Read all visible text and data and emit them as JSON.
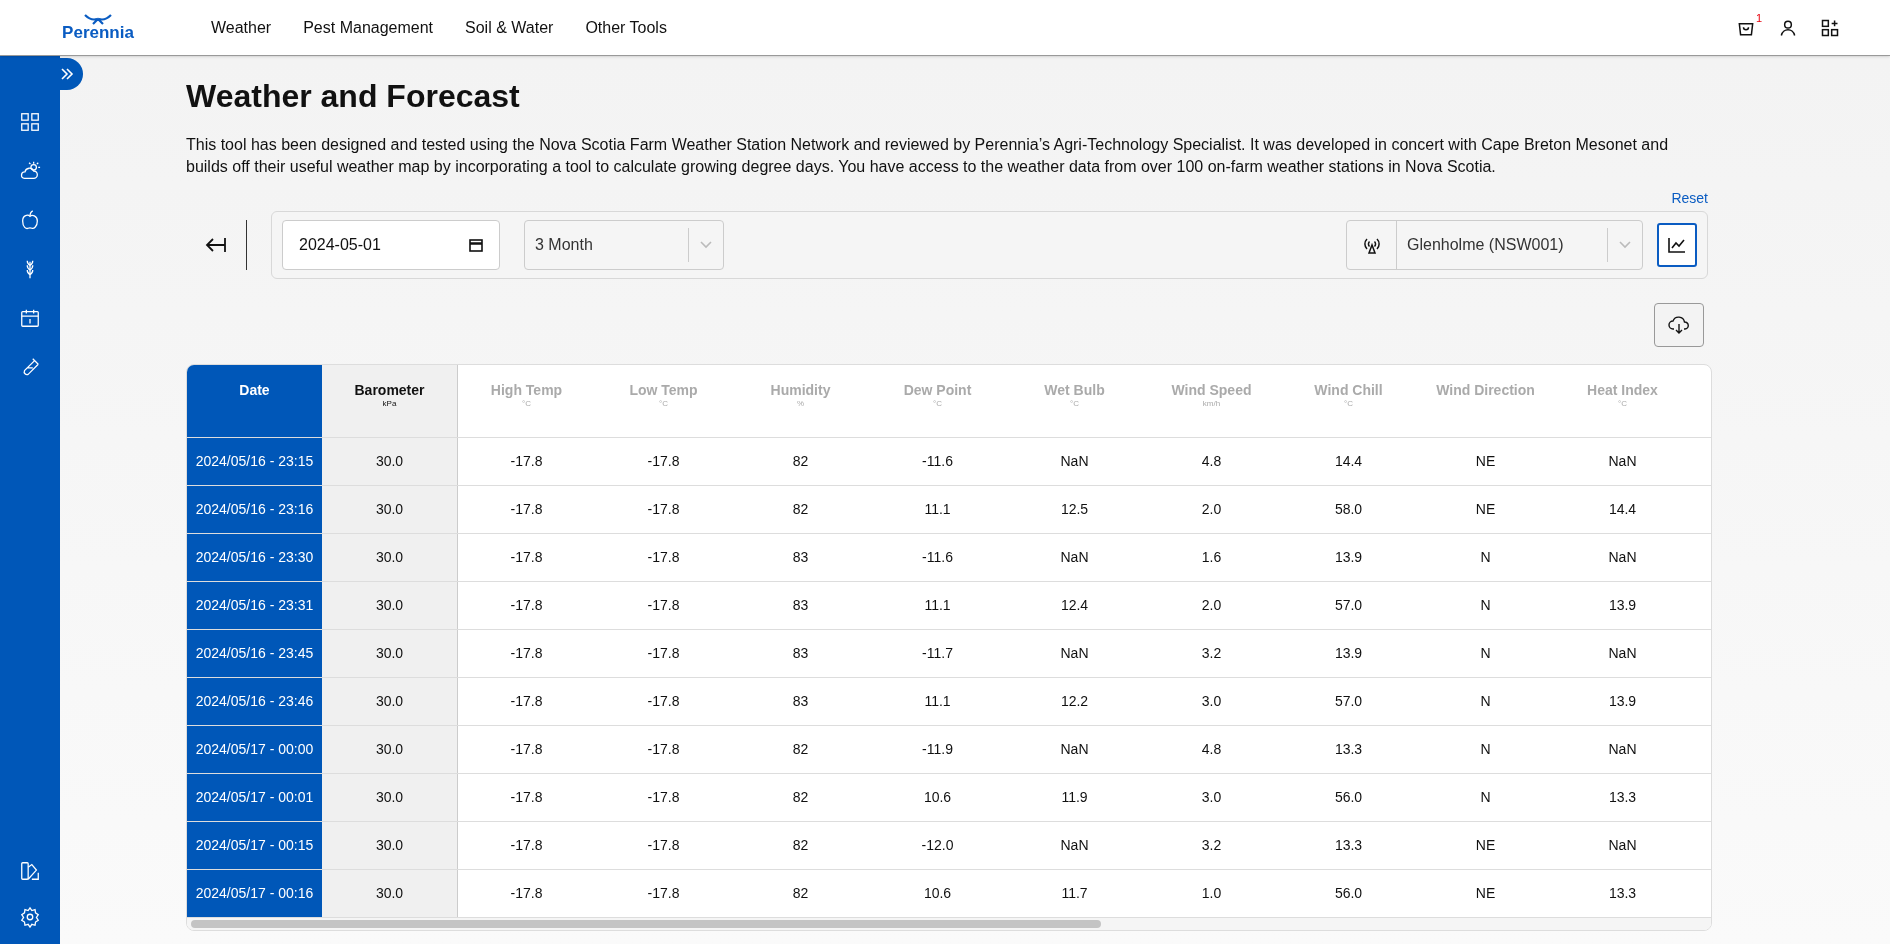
{
  "header": {
    "logo": "Perennia",
    "nav": [
      {
        "label": "Weather"
      },
      {
        "label": "Pest Management"
      },
      {
        "label": "Soil & Water"
      },
      {
        "label": "Other Tools"
      }
    ],
    "cart_badge": "1"
  },
  "sidebar": {
    "items": [
      {
        "kind": "grid"
      },
      {
        "kind": "weather"
      },
      {
        "kind": "apple"
      },
      {
        "kind": "wheat"
      },
      {
        "kind": "calendar"
      },
      {
        "kind": "tube"
      }
    ],
    "bottom_items": [
      {
        "kind": "palette"
      },
      {
        "kind": "settings"
      }
    ]
  },
  "page": {
    "title": "Weather and Forecast",
    "description": "This tool has been designed and tested using the Nova Scotia Farm Weather Station Network and reviewed by Perennia’s Agri-Technology Specialist. It was developed in concert with Cape Breton Mesonet and builds off their useful weather map by incorporating a tool to calculate growing degree days. You have access to the weather data from over 100 on-farm weather stations in Nova Scotia.",
    "reset": "Reset"
  },
  "controls": {
    "date": "2024-05-01",
    "period": "3 Month",
    "station": "Glenholme (NSW001)"
  },
  "table": {
    "columns": [
      {
        "label": "Date",
        "kind": "date"
      },
      {
        "label": "Barometer",
        "unit": "kPa",
        "kind": "pinned"
      },
      {
        "label": "High Temp",
        "unit": "°C",
        "kind": "normal"
      },
      {
        "label": "Low Temp",
        "unit": "°C",
        "kind": "normal"
      },
      {
        "label": "Humidity",
        "unit": "%",
        "kind": "normal"
      },
      {
        "label": "Dew Point",
        "unit": "°C",
        "kind": "normal"
      },
      {
        "label": "Wet Bulb",
        "unit": "°C",
        "kind": "normal"
      },
      {
        "label": "Wind Speed",
        "unit": "km/h",
        "kind": "normal"
      },
      {
        "label": "Wind Chill",
        "unit": "°C",
        "kind": "normal"
      },
      {
        "label": "Wind Direction",
        "kind": "normal"
      },
      {
        "label": "Heat Index",
        "unit": "°C",
        "kind": "normal"
      }
    ],
    "rows": [
      [
        "2024/05/16 - 23:15",
        "30.0",
        "-17.8",
        "-17.8",
        "82",
        "-11.6",
        "NaN",
        "4.8",
        "14.4",
        "NE",
        "NaN"
      ],
      [
        "2024/05/16 - 23:16",
        "30.0",
        "-17.8",
        "-17.8",
        "82",
        "11.1",
        "12.5",
        "2.0",
        "58.0",
        "NE",
        "14.4"
      ],
      [
        "2024/05/16 - 23:30",
        "30.0",
        "-17.8",
        "-17.8",
        "83",
        "-11.6",
        "NaN",
        "1.6",
        "13.9",
        "N",
        "NaN"
      ],
      [
        "2024/05/16 - 23:31",
        "30.0",
        "-17.8",
        "-17.8",
        "83",
        "11.1",
        "12.4",
        "2.0",
        "57.0",
        "N",
        "13.9"
      ],
      [
        "2024/05/16 - 23:45",
        "30.0",
        "-17.8",
        "-17.8",
        "83",
        "-11.7",
        "NaN",
        "3.2",
        "13.9",
        "N",
        "NaN"
      ],
      [
        "2024/05/16 - 23:46",
        "30.0",
        "-17.8",
        "-17.8",
        "83",
        "11.1",
        "12.2",
        "3.0",
        "57.0",
        "N",
        "13.9"
      ],
      [
        "2024/05/17 - 00:00",
        "30.0",
        "-17.8",
        "-17.8",
        "82",
        "-11.9",
        "NaN",
        "4.8",
        "13.3",
        "N",
        "NaN"
      ],
      [
        "2024/05/17 - 00:01",
        "30.0",
        "-17.8",
        "-17.8",
        "82",
        "10.6",
        "11.9",
        "3.0",
        "56.0",
        "N",
        "13.3"
      ],
      [
        "2024/05/17 - 00:15",
        "30.0",
        "-17.8",
        "-17.8",
        "82",
        "-12.0",
        "NaN",
        "3.2",
        "13.3",
        "NE",
        "NaN"
      ],
      [
        "2024/05/17 - 00:16",
        "30.0",
        "-17.8",
        "-17.8",
        "82",
        "10.6",
        "11.7",
        "1.0",
        "56.0",
        "NE",
        "13.3"
      ]
    ]
  }
}
